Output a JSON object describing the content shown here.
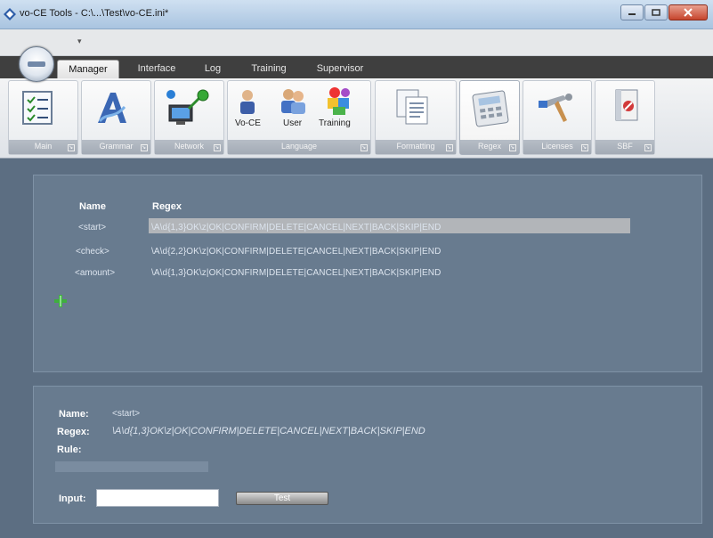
{
  "window": {
    "title": "vo-CE Tools - C:\\...\\Test\\vo-CE.ini*"
  },
  "tabs": [
    {
      "label": "Manager",
      "active": true
    },
    {
      "label": "Interface",
      "active": false
    },
    {
      "label": "Log",
      "active": false
    },
    {
      "label": "Training",
      "active": false
    },
    {
      "label": "Supervisor",
      "active": false
    }
  ],
  "ribbon": {
    "groups": [
      {
        "label": "Main",
        "icon": "checklist-icon"
      },
      {
        "label": "Grammar",
        "icon": "text-font-icon"
      },
      {
        "label": "Network",
        "icon": "network-computer-icon"
      },
      {
        "label": "Language",
        "buttons": [
          {
            "label": "Vo-CE",
            "icon": "vo-ce-user-icon"
          },
          {
            "label": "User",
            "icon": "users-icon"
          },
          {
            "label": "Training",
            "icon": "training-blocks-icon"
          }
        ]
      },
      {
        "label": "Formatting",
        "icon": "documents-icon"
      },
      {
        "label": "Regex",
        "icon": "calculator-icon",
        "selected": true
      },
      {
        "label": "Licenses",
        "icon": "tools-icon"
      },
      {
        "label": "SBF",
        "icon": "book-icon"
      }
    ]
  },
  "regex_table": {
    "headers": {
      "name": "Name",
      "regex": "Regex"
    },
    "rows": [
      {
        "name": "<start>",
        "regex": "\\A\\d{1,3}OK\\z|OK|CONFIRM|DELETE|CANCEL|NEXT|BACK|SKIP|END",
        "selected": true
      },
      {
        "name": "<check>",
        "regex": "\\A\\d{2,2}OK\\z|OK|CONFIRM|DELETE|CANCEL|NEXT|BACK|SKIP|END",
        "selected": false
      },
      {
        "name": "<amount>",
        "regex": "\\A\\d{1,3}OK\\z|OK|CONFIRM|DELETE|CANCEL|NEXT|BACK|SKIP|END",
        "selected": false
      }
    ]
  },
  "details": {
    "name_label": "Name:",
    "name_value": "<start>",
    "regex_label": "Regex:",
    "regex_value": "\\A\\d{1,3}OK\\z|OK|CONFIRM|DELETE|CANCEL|NEXT|BACK|SKIP|END",
    "rule_label": "Rule:",
    "input_label": "Input:",
    "input_value": "",
    "test_button": "Test"
  },
  "colors": {
    "panel_bg": "#687b8f",
    "app_bg": "#5c6e82",
    "selection": "#b2b5b9"
  }
}
